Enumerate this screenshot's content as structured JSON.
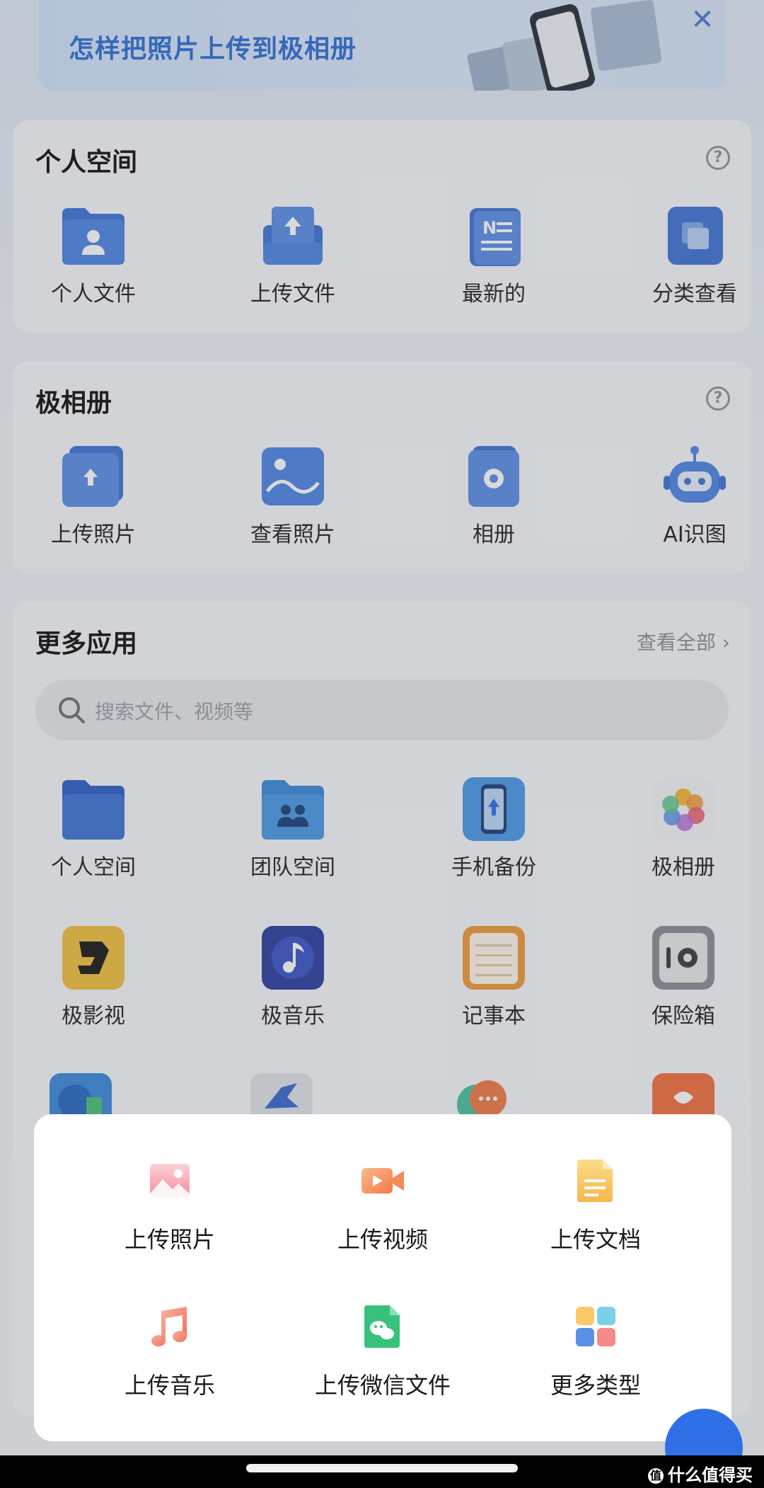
{
  "banner": {
    "text": "怎样把照片上传到极相册",
    "close": "✕"
  },
  "personal_space": {
    "title": "个人空间",
    "help": "?",
    "items": [
      {
        "label": "个人文件"
      },
      {
        "label": "上传文件"
      },
      {
        "label": "最新的"
      },
      {
        "label": "分类查看"
      }
    ]
  },
  "album": {
    "title": "极相册",
    "help": "?",
    "items": [
      {
        "label": "上传照片"
      },
      {
        "label": "查看照片"
      },
      {
        "label": "相册"
      },
      {
        "label": "AI识图"
      }
    ]
  },
  "more_apps": {
    "title": "更多应用",
    "see_all": "查看全部 ›",
    "search_placeholder": "搜索文件、视频等",
    "items": [
      {
        "label": "个人空间"
      },
      {
        "label": "团队空间"
      },
      {
        "label": "手机备份"
      },
      {
        "label": "极相册"
      },
      {
        "label": "极影视"
      },
      {
        "label": "极音乐"
      },
      {
        "label": "记事本"
      },
      {
        "label": "保险箱"
      }
    ]
  },
  "upload_sheet": {
    "items": [
      {
        "label": "上传照片",
        "icon": "image-icon"
      },
      {
        "label": "上传视频",
        "icon": "video-icon"
      },
      {
        "label": "上传文档",
        "icon": "document-icon"
      },
      {
        "label": "上传音乐",
        "icon": "music-icon"
      },
      {
        "label": "上传微信文件",
        "icon": "wechat-file-icon"
      },
      {
        "label": "更多类型",
        "icon": "more-types-icon"
      }
    ]
  },
  "watermark": "什么值得买",
  "colors": {
    "accent": "#2f6fe8",
    "icon_blue": "#3d7be0"
  }
}
